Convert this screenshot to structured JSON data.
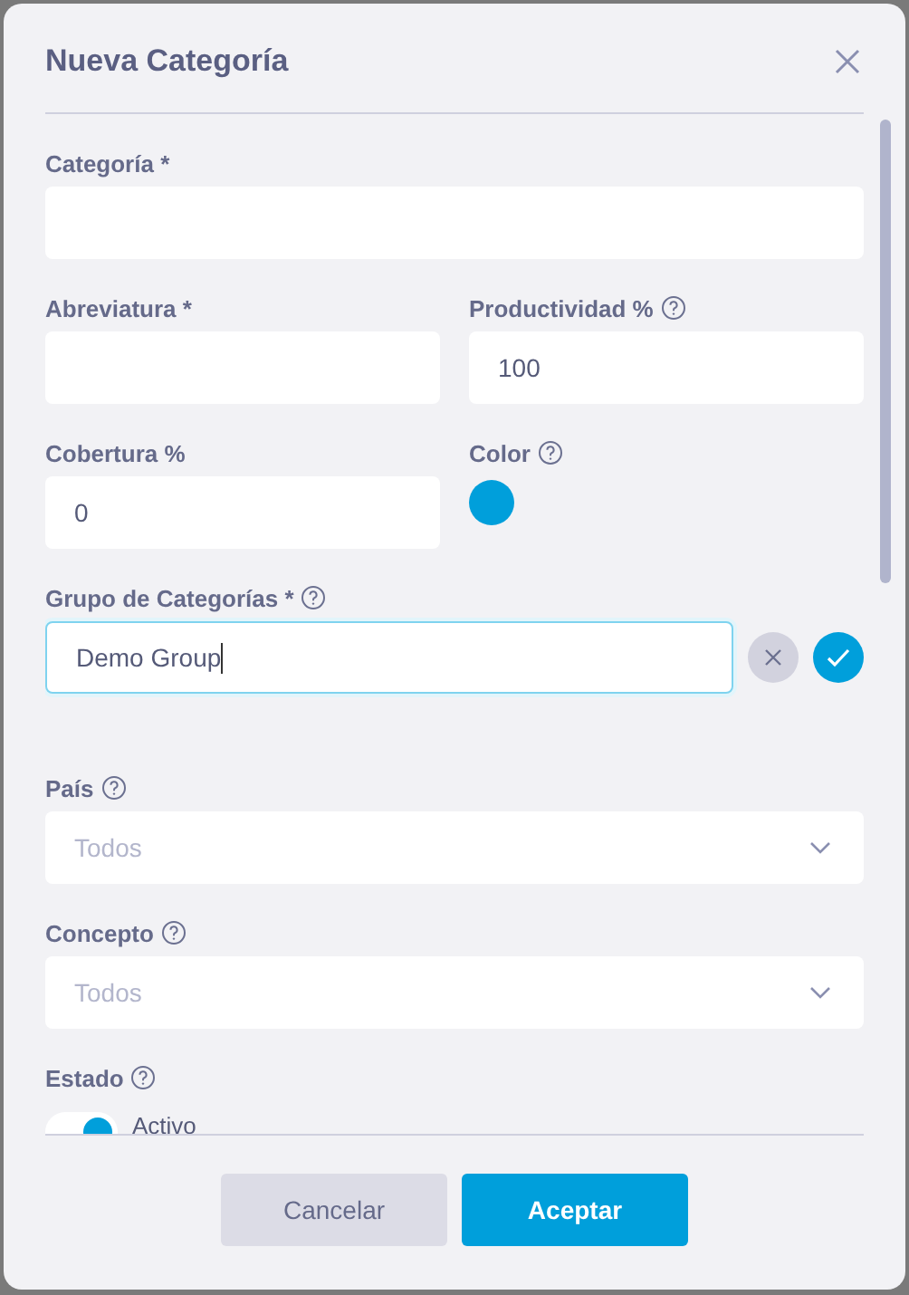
{
  "dialog": {
    "title": "Nueva Categoría"
  },
  "rows": [
    [
      {
        "kind": "text",
        "label": "Categoría *",
        "help": false
      }
    ],
    [
      {
        "kind": "text",
        "label": "Abreviatura *",
        "help": false
      },
      {
        "kind": "text",
        "label": "Productividad %",
        "help": true,
        "value": "100"
      }
    ],
    [
      {
        "kind": "text",
        "label": "Cobertura %",
        "help": false,
        "value": "0"
      },
      {
        "kind": "color",
        "label": "Color",
        "help": true,
        "color": "#009fdb"
      }
    ],
    [
      {
        "kind": "combo",
        "label": "Grupo de Categorías *",
        "help": true,
        "value": "Demo Group",
        "focused": true
      }
    ],
    [
      {
        "kind": "select",
        "label": "País",
        "help": true,
        "placeholder": "Todos"
      }
    ],
    [
      {
        "kind": "select",
        "label": "Concepto",
        "help": true,
        "placeholder": "Todos"
      }
    ],
    [
      {
        "kind": "toggle",
        "label": "Estado",
        "help": true,
        "on": true,
        "option": "Activo"
      }
    ]
  ],
  "buttons": [
    {
      "label": "Cancelar",
      "primary": false
    },
    {
      "label": "Aceptar",
      "primary": true
    }
  ]
}
